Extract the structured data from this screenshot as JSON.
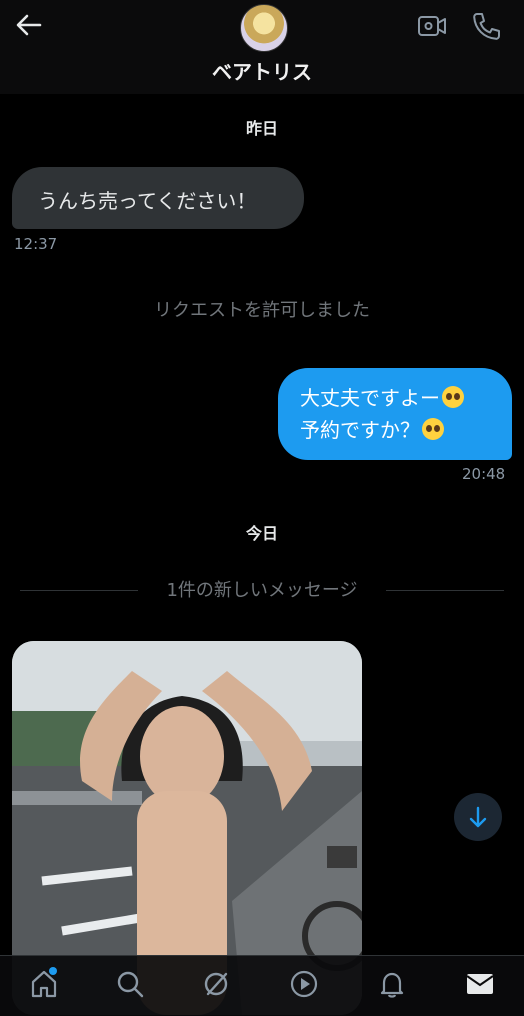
{
  "header": {
    "title": "ベアトリス"
  },
  "dates": {
    "yesterday": "昨日",
    "today": "今日"
  },
  "messages": {
    "incoming_text": "うんち売ってください！",
    "incoming_time": "12:37",
    "system_notice": "リクエストを許可しました",
    "outgoing_line1": "大丈夫ですよー",
    "outgoing_line2": "予約ですか？",
    "outgoing_time": "20:48",
    "new_messages_divider": "1件の新しいメッセージ"
  },
  "icons": {
    "back": "back-arrow-icon",
    "video": "video-call-icon",
    "phone": "phone-icon",
    "scroll_down": "arrow-down-icon",
    "emoji": "pleading-face-emoji"
  },
  "nav": {
    "items": [
      "home",
      "search",
      "spaces",
      "media",
      "notifications",
      "messages"
    ],
    "notification_dot_color": "#1d9bf0"
  },
  "colors": {
    "background": "#000000",
    "incoming_bubble": "#2f3336",
    "outgoing_bubble": "#1d9bf0",
    "accent": "#1d9bf0",
    "muted_text": "#71767b"
  }
}
